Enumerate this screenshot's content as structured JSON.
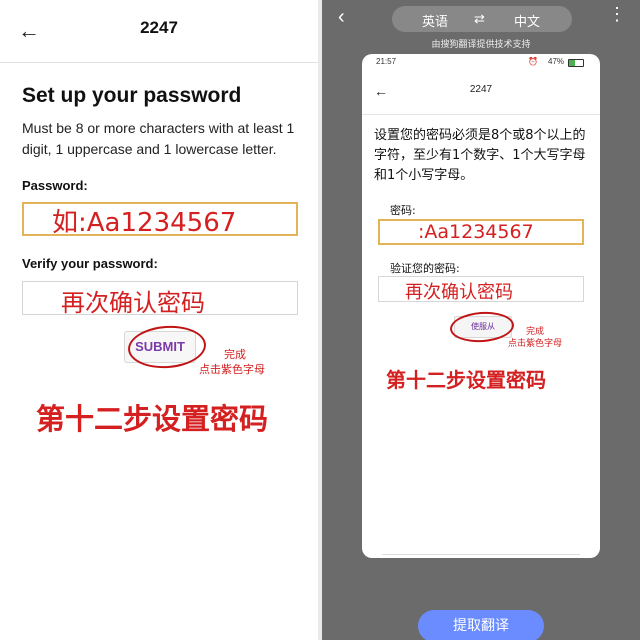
{
  "left": {
    "header": {
      "back_icon": "arrow-left-icon",
      "title": "2247"
    },
    "heading": "Set up your password",
    "description": "Must be 8 or more characters with at least 1 digit, 1 uppercase and 1 lowercase letter.",
    "password_label": "Password:",
    "password_value": "如:Aa1234567",
    "verify_label": "Verify your password:",
    "verify_value": "再次确认密码",
    "submit_label": "SUBMIT",
    "annotation_line1": "完成",
    "annotation_line2": "点击紫色字母",
    "step_text": "第十二步设置密码"
  },
  "right": {
    "topbar": {
      "back_icon": "chevron-left-icon",
      "source_lang": "英语",
      "swap_icon": "swap-icon",
      "target_lang": "中文",
      "menu_icon": "more-icon"
    },
    "provider_note": "由搜狗翻译提供技术支持",
    "status": {
      "time": "21:57",
      "battery": "47%"
    },
    "phone_header": {
      "back_icon": "arrow-left-icon",
      "title": "2247"
    },
    "description": "设置您的密码必须是8个或8个以上的字符，至少有1个数字、1个大写字母和1个小写字母。",
    "password_label": "密码:",
    "password_value": ":Aa1234567",
    "verify_label": "验证您的密码:",
    "verify_value": "再次确认密码",
    "submit_label": "使服从",
    "annotation_line1": "完成",
    "annotation_line2": "点击紫色字母",
    "step_text": "第十二步设置密码",
    "translate_button": "提取翻译"
  },
  "colors": {
    "annotation_red": "#d42020",
    "submit_purple": "#7c3aa8",
    "field_highlight": "#e3b35a",
    "translate_blue": "#6a8cff"
  }
}
